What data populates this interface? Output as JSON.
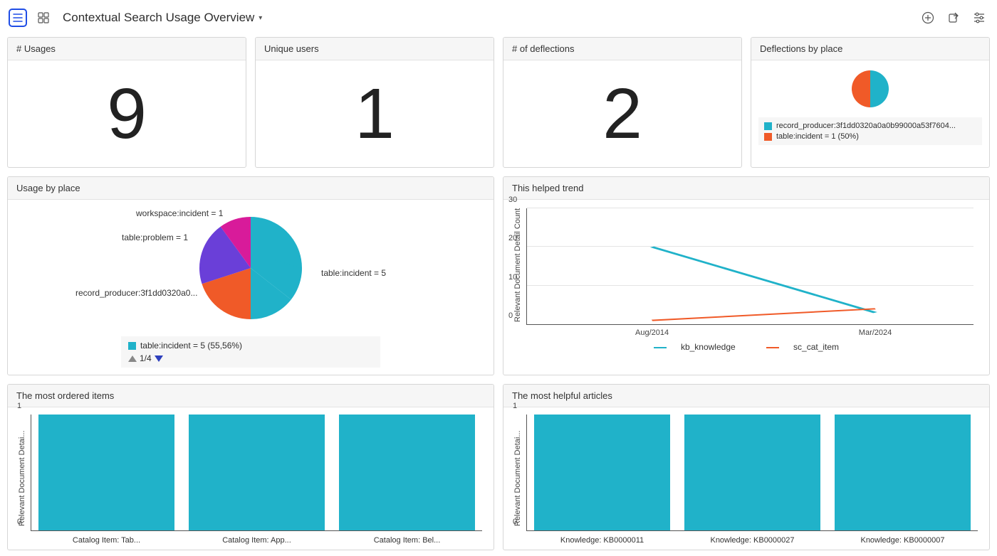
{
  "header": {
    "title": "Contextual Search Usage Overview"
  },
  "cards": {
    "usages": {
      "title": "# Usages",
      "value": "9"
    },
    "unique_users": {
      "title": "Unique users",
      "value": "1"
    },
    "deflections": {
      "title": "# of deflections",
      "value": "2"
    },
    "deflections_by_place": {
      "title": "Deflections by place",
      "legend1": "record_producer:3f1dd0320a0a0b99000a53f7604...",
      "legend2": "table:incident = 1 (50%)"
    },
    "usage_by_place": {
      "title": "Usage by place",
      "lbl_workspace": "workspace:incident = 1",
      "lbl_problem": "table:problem = 1",
      "lbl_incident": "table:incident = 5",
      "lbl_record": "record_producer:3f1dd0320a0...",
      "legend": "table:incident = 5 (55,56%)",
      "pager": "1/4"
    },
    "helped_trend": {
      "title": "This helped trend",
      "ylabel": "Relevant Document Detail Count",
      "x1": "Aug/2014",
      "x2": "Mar/2024",
      "s1": "kb_knowledge",
      "s2": "sc_cat_item",
      "t0": "0",
      "t10": "10",
      "t20": "20",
      "t30": "30"
    },
    "ordered_items": {
      "title": "The most ordered items",
      "ylabel": "Relevant Document Detai...",
      "tick0": "0",
      "tick1": "1",
      "b1": "Catalog Item: Tab...",
      "b2": "Catalog Item: App...",
      "b3": "Catalog Item: Bel..."
    },
    "helpful_articles": {
      "title": "The most helpful articles",
      "ylabel": "Relevant Document Detai...",
      "tick0": "0",
      "tick1": "1",
      "b1": "Knowledge: KB0000011",
      "b2": "Knowledge: KB0000027",
      "b3": "Knowledge: KB0000007"
    }
  },
  "colors": {
    "teal": "#20b2c9",
    "orange": "#f05a28",
    "purple": "#6a3fd8",
    "magenta": "#d81b9a"
  },
  "chart_data": [
    {
      "type": "pie",
      "title": "Deflections by place",
      "categories": [
        "record_producer:3f1dd0320a0a0b99000a53f7604...",
        "table:incident"
      ],
      "values": [
        1,
        1
      ]
    },
    {
      "type": "pie",
      "title": "Usage by place",
      "categories": [
        "table:incident",
        "record_producer:3f1dd0320a0...",
        "table:problem",
        "workspace:incident"
      ],
      "values": [
        5,
        2,
        1,
        1
      ]
    },
    {
      "type": "line",
      "title": "This helped trend",
      "ylabel": "Relevant Document Detail Count",
      "x": [
        "Aug/2014",
        "Mar/2024"
      ],
      "series": [
        {
          "name": "kb_knowledge",
          "values": [
            20,
            3
          ]
        },
        {
          "name": "sc_cat_item",
          "values": [
            1,
            4
          ]
        }
      ],
      "ylim": [
        0,
        30
      ]
    },
    {
      "type": "bar",
      "title": "The most ordered items",
      "ylabel": "Relevant Document Detail Count",
      "categories": [
        "Catalog Item: Tab...",
        "Catalog Item: App...",
        "Catalog Item: Bel..."
      ],
      "values": [
        1,
        1,
        1
      ],
      "ylim": [
        0,
        1
      ]
    },
    {
      "type": "bar",
      "title": "The most helpful articles",
      "ylabel": "Relevant Document Detail Count",
      "categories": [
        "Knowledge: KB0000011",
        "Knowledge: KB0000027",
        "Knowledge: KB0000007"
      ],
      "values": [
        1,
        1,
        1
      ],
      "ylim": [
        0,
        1
      ]
    }
  ]
}
